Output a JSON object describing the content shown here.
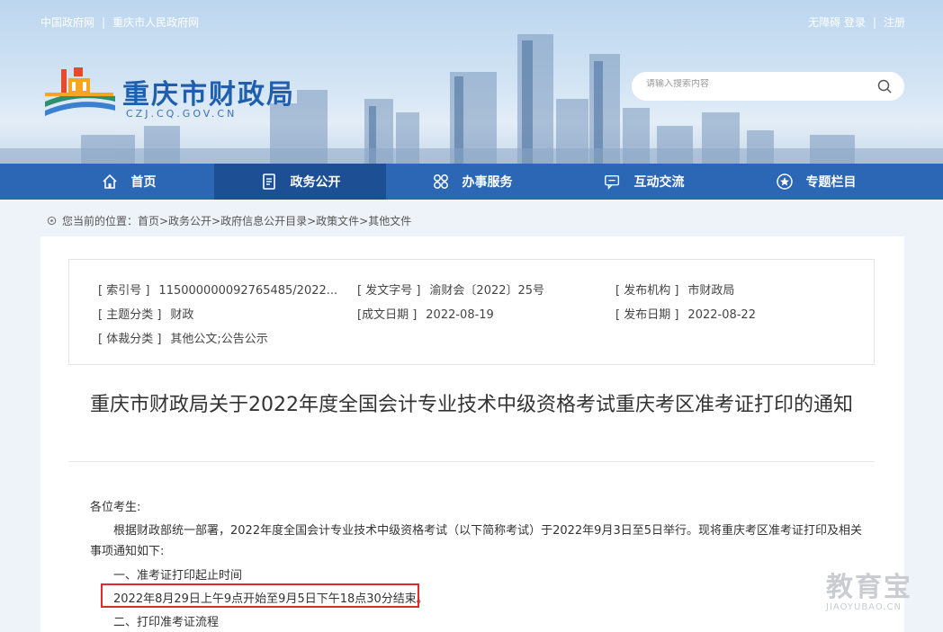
{
  "header": {
    "top_links": [
      "中国政府网",
      "重庆市人民政府网"
    ],
    "account_links": [
      "无障碍 登录",
      "注册"
    ],
    "site_title": "重庆市财政局",
    "site_domain": "CZJ.CQ.GOV.CN",
    "search_placeholder": "请输入搜索内容"
  },
  "nav": {
    "items": [
      {
        "label": "首页",
        "icon": "home-icon"
      },
      {
        "label": "政务公开",
        "icon": "document-icon",
        "active": true
      },
      {
        "label": "办事服务",
        "icon": "grid-icon"
      },
      {
        "label": "互动交流",
        "icon": "chat-icon"
      },
      {
        "label": "专题栏目",
        "icon": "star-icon"
      }
    ]
  },
  "breadcrumb": "您当前的位置：首页>政务公开>政府信息公开目录>政策文件>其他文件",
  "meta": {
    "index_key": "[ 索引号 ]",
    "index_val": "11500000009276548​5/2022...",
    "doc_no_key": "[ 发文字号 ]",
    "doc_no_val": "渝财会〔2022〕25号",
    "publisher_key": "[ 发布机构 ]",
    "publisher_val": "市财政局",
    "topic_key": "[ 主题分类 ]",
    "topic_val": "财政",
    "created_key": "[成文日期 ]",
    "created_val": "2022-08-19",
    "published_key": "[ 发布日期 ]",
    "published_val": "2022-08-22",
    "genre_key": "[ 体裁分类 ]",
    "genre_val": "其他公文;公告公示"
  },
  "article": {
    "title": "重庆市财政局关于2022年度全国会计专业技术中级资格考试重庆考区准考证打印的通知",
    "salutation": "各位考生:",
    "para1": "根据财政部统一部署，2022年度全国会计专业技术中级资格考试（以下简称考试）于2022年9月3日至5日举行。现将重庆考区准考证打印及相关",
    "para1_cont": "事项通知如下:",
    "section1": "一、准考证打印起止时间",
    "section1_text": "2022年8月29日上午9点开始至9月5日下午18点30分结束。",
    "section2": "二、打印准考证流程"
  },
  "watermark": {
    "main": "教育宝",
    "sub": "JIAOYUBAO.CN"
  },
  "colors": {
    "nav_bg": "#2c67b5",
    "nav_active": "#1d4f95",
    "title_blue": "#1f5fae",
    "highlight": "#e12b2b"
  }
}
